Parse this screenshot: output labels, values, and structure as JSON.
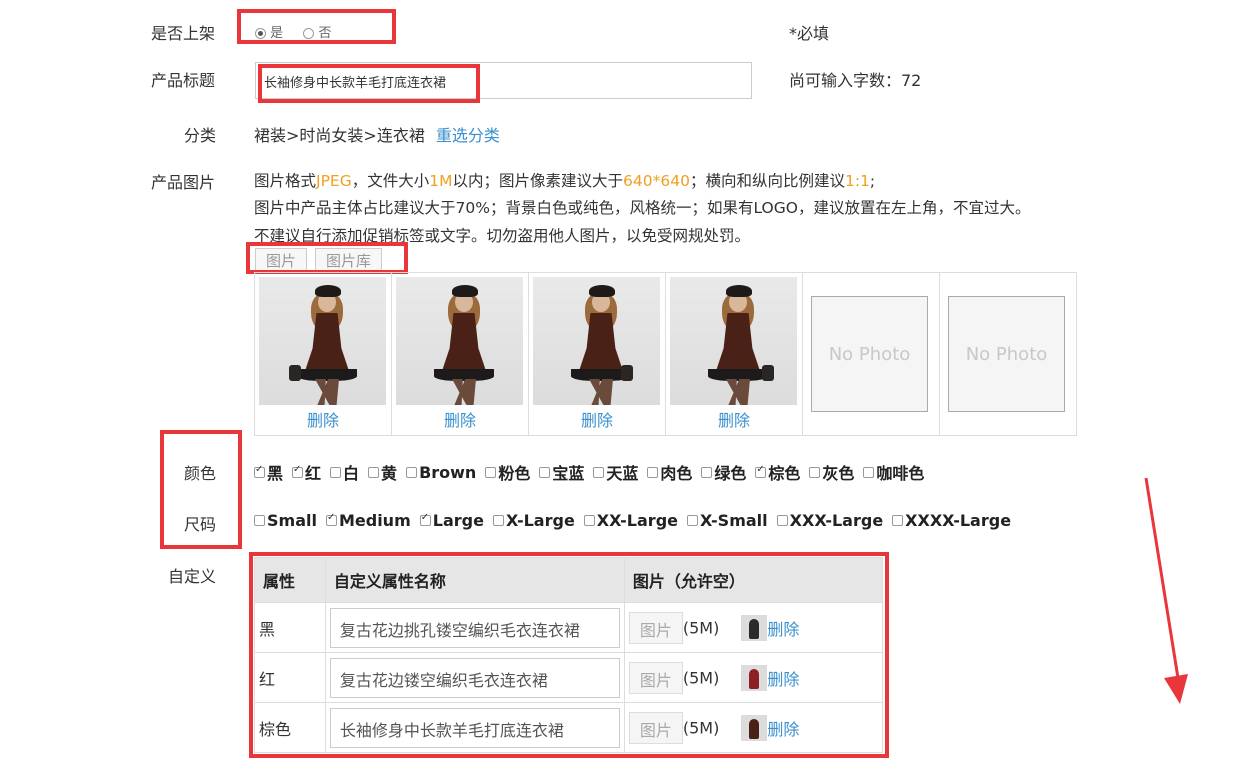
{
  "form": {
    "shelf_label": "是否上架",
    "shelf_yes": "是",
    "shelf_no": "否",
    "required_note": "*必填",
    "title_label": "产品标题",
    "title_value": "长袖修身中长款羊毛打底连衣裙",
    "remaining_chars_label": "尚可输入字数：72",
    "category_label": "分类",
    "category_path": "裙装>时尚女装>连衣裙",
    "reselect_category": "重选分类",
    "images_label": "产品图片",
    "images_desc": {
      "line1_a": "图片格式",
      "line1_fmt": "JPEG",
      "line1_b": "，文件大小",
      "line1_size": "1M",
      "line1_c": "以内；图片像素建议大于",
      "line1_px": "640*640",
      "line1_d": "；横向和纵向比例建议",
      "line1_ratio": "1:1",
      "line1_e": ";",
      "line2": "图片中产品主体占比建议大于70%；背景白色或纯色，风格统一；如果有LOGO，建议放置在左上角，不宜过大。",
      "line3": "不建议自行添加促销标签或文字。切勿盗用他人图片，以免受网规处罚。"
    },
    "image_tabs": [
      "图片",
      "图片库"
    ],
    "image_cells": [
      {
        "delete": "删除"
      },
      {
        "delete": "删除"
      },
      {
        "delete": "删除"
      },
      {
        "delete": "删除"
      },
      {
        "placeholder": "No Photo"
      },
      {
        "placeholder": "No Photo"
      }
    ],
    "color_label": "颜色",
    "colors": [
      {
        "label": "黑",
        "checked": true
      },
      {
        "label": "红",
        "checked": true
      },
      {
        "label": "白",
        "checked": false
      },
      {
        "label": "黄",
        "checked": false
      },
      {
        "label": "Brown",
        "checked": false
      },
      {
        "label": "粉色",
        "checked": false
      },
      {
        "label": "宝蓝",
        "checked": false
      },
      {
        "label": "天蓝",
        "checked": false
      },
      {
        "label": "肉色",
        "checked": false
      },
      {
        "label": "绿色",
        "checked": false
      },
      {
        "label": "棕色",
        "checked": true
      },
      {
        "label": "灰色",
        "checked": false
      },
      {
        "label": "咖啡色",
        "checked": false
      }
    ],
    "size_label": "尺码",
    "sizes": [
      {
        "label": "Small",
        "checked": false
      },
      {
        "label": "Medium",
        "checked": true
      },
      {
        "label": "Large",
        "checked": true
      },
      {
        "label": "X-Large",
        "checked": false
      },
      {
        "label": "XX-Large",
        "checked": false
      },
      {
        "label": "X-Small",
        "checked": false
      },
      {
        "label": "XXX-Large",
        "checked": false
      },
      {
        "label": "XXXX-Large",
        "checked": false
      }
    ],
    "custom_label": "自定义",
    "custom_table": {
      "headers": [
        "属性",
        "自定义属性名称",
        "图片（允许空）"
      ],
      "rows": [
        {
          "attr": "黑",
          "name": "复古花边挑孔镂空编织毛衣连衣裙",
          "pic_btn": "图片",
          "size": "(5M)",
          "delete": "删除",
          "thumb_color": "#2a2a2a"
        },
        {
          "attr": "红",
          "name": "复古花边镂空编织毛衣连衣裙",
          "pic_btn": "图片",
          "size": "(5M)",
          "delete": "删除",
          "thumb_color": "#8e1f24"
        },
        {
          "attr": "棕色",
          "name": "长袖修身中长款羊毛打底连衣裙",
          "pic_btn": "图片",
          "size": "(5M)",
          "delete": "删除",
          "thumb_color": "#4a2117"
        }
      ]
    }
  },
  "colors": {
    "highlight_red": "#e8363b",
    "link_blue": "#3a8fcf",
    "accent_orange": "#f0a020"
  }
}
